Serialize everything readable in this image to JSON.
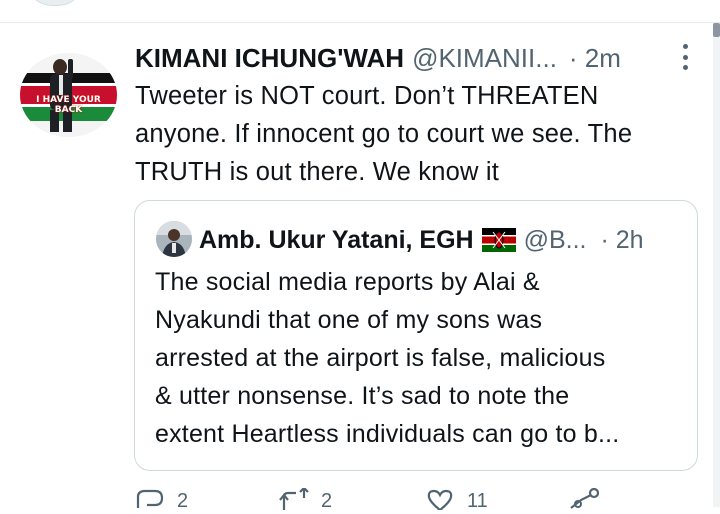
{
  "colors": {
    "text": "#0f1419",
    "secondary": "#536471",
    "border": "#cfd9de"
  },
  "tweet": {
    "author_name": "KIMANI ICHUNG'WAH",
    "author_handle": "@KIMANII...",
    "time": "· 2m",
    "avatar_caption": "I HAVE YOUR BACK",
    "text_lines": [
      "Tweeter is NOT court. Don’t THREATEN",
      "anyone. If innocent go to court we see. The",
      "TRUTH is out there. We know it"
    ]
  },
  "quoted_tweet": {
    "author_name": "Amb. Ukur Yatani, EGH",
    "flag_icon": "kenya-flag-icon",
    "author_handle": "@B...",
    "time": "· 2h",
    "text_lines": [
      "The social media reports by Alai &",
      "Nyakundi that one of my sons  was",
      "arrested at the airport is false, malicious",
      "& utter nonsense. It’s sad to note the",
      "extent Heartless individuals can go to b..."
    ]
  },
  "actions": {
    "reply_count": "2",
    "retweet_count": "2",
    "like_count": "11"
  }
}
